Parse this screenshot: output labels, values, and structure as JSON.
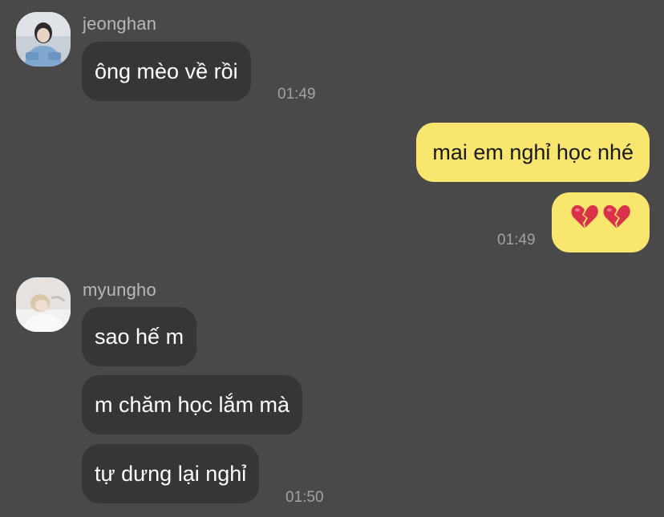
{
  "theme": {
    "background": "#4a4949",
    "incoming_bubble": "#363636",
    "outgoing_bubble": "#f8e66e",
    "heart_color": "#d9324a"
  },
  "messages": {
    "group1": {
      "sender": "jeonghan",
      "avatar_icon": "profile-photo-jeonghan",
      "text1": "ông mèo về rồi",
      "time": "01:49"
    },
    "outgoing": {
      "text1": "mai em nghỉ học nhé",
      "emoji_icons": [
        "broken-heart-icon",
        "broken-heart-icon"
      ],
      "time": "01:49"
    },
    "group2": {
      "sender": "myungho",
      "avatar_icon": "profile-photo-myungho",
      "text1": "sao hế m",
      "text2": "m chăm học lắm mà",
      "text3": "tự dưng lại nghỉ",
      "time": "01:50"
    }
  }
}
